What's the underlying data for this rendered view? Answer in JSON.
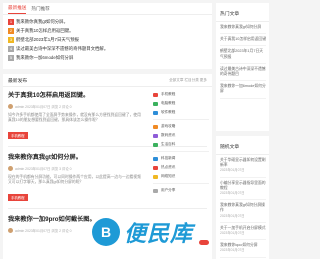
{
  "news": {
    "tabs": [
      "最新推送",
      "热门推荐"
    ],
    "items": [
      "我来教你真我gt如何分屏。",
      "关于真我10怎样启用返回键。",
      "鹤壁北部2023年1月7日天气预报",
      "读过最美古诗中深深不遗憾的奇伟题目文档解。",
      "我来教你一加6mode如何分屏"
    ]
  },
  "hot": {
    "title": "热门文章",
    "items": [
      {
        "text": "我来教你真我gt如何分屏"
      },
      {
        "text": "关于真我10怎样启用返回键"
      },
      {
        "text": "鹤壁北部2023年1月7日天气预报"
      },
      {
        "text": "读过最美古诗中深深不遗憾的奇伟题目"
      },
      {
        "text": "我来教你一加6mode如何分屏"
      }
    ]
  },
  "recent": {
    "title": "随机文章",
    "items": [
      {
        "text": "关于华硕显示器如何设置刷新率",
        "date": "2023年01月07日"
      },
      {
        "text": "小编分享显示器指导里面的教程",
        "date": "2023年01月07日"
      },
      {
        "text": "我来教你真我gt如何分屏操作",
        "date": "2023年01月07日"
      },
      {
        "text": "关于一加手机开启分屏模式",
        "date": "2023年01月07日"
      },
      {
        "text": "我来教你iqoo如何分屏",
        "date": "2023年01月07日"
      }
    ]
  },
  "feed": {
    "title": "最新发布",
    "right": "全部文章  栏目分类  更多",
    "posts": [
      {
        "title": "关于真我10怎样启用返回键。",
        "meta": "admin  2023年01月07日  浏览 2  评论 0",
        "excerpt": "如今许多手机都使用了全面屏手势来操作，就没有那么方便找到返回键了，使用真我10的朋友想要找到返回键，那具体该怎么操作呢？",
        "tag": "手机教程"
      },
      {
        "title": "我来教你真我gt如何分屏。",
        "meta": "admin  2023年01月07日  浏览 3  评论 0",
        "excerpt": "现在的手机都有分屏功能，可以同时操作两个应用，以此提高一边与一边看视频又可以打字聊天，那么真我gt如何分屏的呢？",
        "tag": "手机教程"
      },
      {
        "title": "我来教你一加9pro如何截长图。",
        "meta": "admin  2023年01月07日  浏览 2  评论 0",
        "excerpt": "",
        "tag": ""
      }
    ]
  },
  "catmenu": {
    "items": [
      "手机教程",
      "电脑教程",
      "软件教程",
      "游戏攻略",
      "数码资讯",
      "生活百科",
      "科技新闻",
      "热点资讯",
      "网络知识",
      "用户分享"
    ]
  },
  "watermark": {
    "logo": "B",
    "text": "便民库"
  },
  "colors": {
    "accent": "#e8443b",
    "watermark": "#1e9ad6"
  }
}
